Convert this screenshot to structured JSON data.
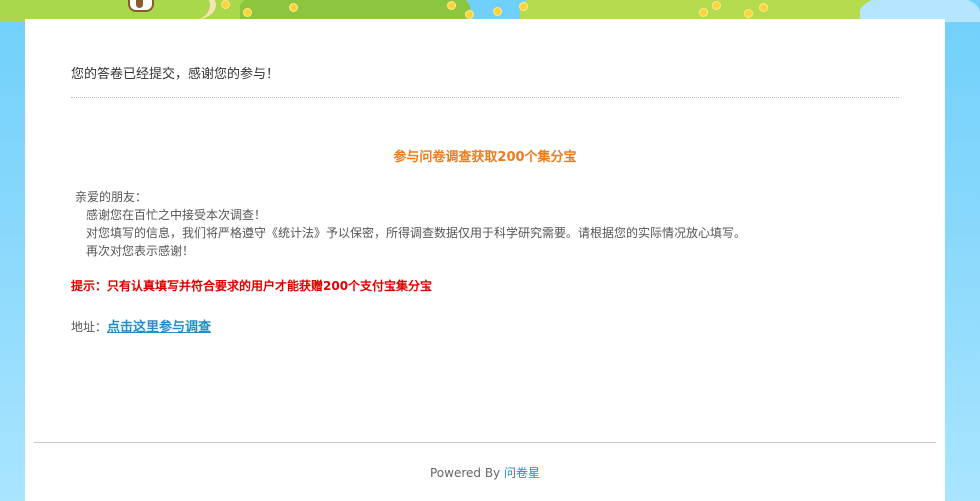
{
  "card": {
    "submitted_message": "您的答卷已经提交，感谢您的参与！",
    "promo_title": "参与问卷调查获取200个集分宝",
    "letter": {
      "greeting": "亲爱的朋友：",
      "line1": "感谢您在百忙之中接受本次调查！",
      "line2": "对您填写的信息，我们将严格遵守《统计法》予以保密，所得调查数据仅用于科学研究需要。请根据您的实际情况放心填写。",
      "line3": "再次对您表示感谢！"
    },
    "tip": "提示：只有认真填写并符合要求的用户才能获赠200个支付宝集分宝",
    "address": {
      "label": "地址：",
      "link_text": "点击这里参与调查"
    }
  },
  "footer": {
    "powered_by": "Powered By",
    "brand": "问卷星"
  },
  "colors": {
    "background": "#8bd9fc",
    "promo_orange": "#f07b1b",
    "tip_red": "#e00000",
    "link_blue": "#1f8fc7"
  }
}
